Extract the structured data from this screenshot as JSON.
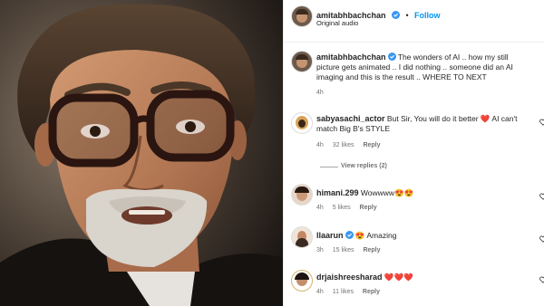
{
  "post": {
    "author": "amitabhbachchan",
    "follow_label": "Follow",
    "audio_label": "Original audio",
    "caption": "The wonders of AI .. how my still picture gets animated .. I did nothing .. someone did an AI imaging and this is the result .. WHERE TO NEXT",
    "caption_time": "4h"
  },
  "comments": [
    {
      "user": "sabyasachi_actor",
      "verified": false,
      "text": "But Sir, You will do it better ❤️ AI can't match Big B's STYLE",
      "time": "4h",
      "likes": "32 likes",
      "reply": "Reply",
      "view_replies": "View replies (2)"
    },
    {
      "user": "himani.299",
      "verified": false,
      "text": "Wowwww😍😍",
      "time": "4h",
      "likes": "5 likes",
      "reply": "Reply"
    },
    {
      "user": "llaarun",
      "verified": true,
      "text": "😍 Amazing",
      "time": "3h",
      "likes": "15 likes",
      "reply": "Reply"
    },
    {
      "user": "drjaishreesharad",
      "verified": false,
      "text": "❤️❤️❤️",
      "time": "4h",
      "likes": "11 likes",
      "reply": "Reply"
    }
  ],
  "colors": {
    "accent": "#0095f6",
    "verified": "#3897f0",
    "heart": "#ed4956"
  }
}
